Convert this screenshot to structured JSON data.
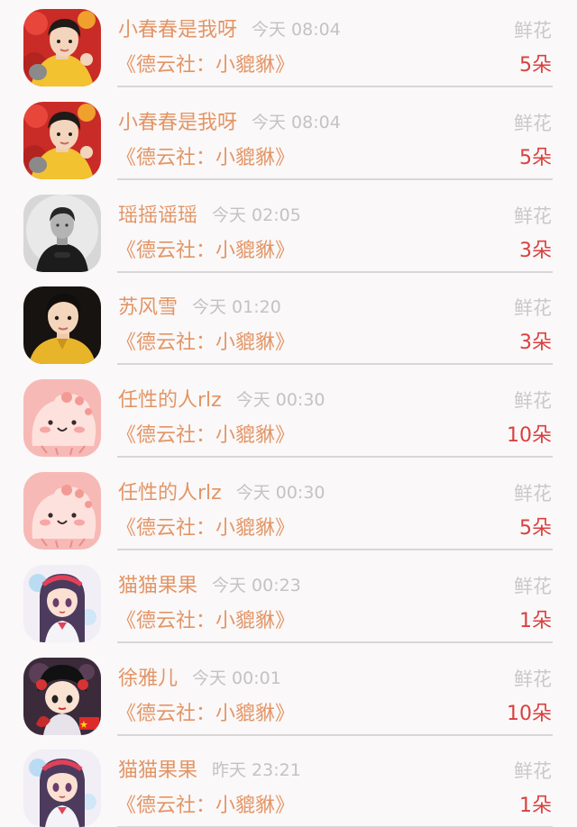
{
  "colors": {
    "name": "#e39566",
    "time": "#c3c3c3",
    "gift": "#c9c9c9",
    "count": "#d9403f",
    "divider": "#d8d6d6"
  },
  "rows": [
    {
      "avatar": "man-yellow-red-avatar",
      "name": "小春春是我呀",
      "time": "今天 08:04",
      "gift": "鲜花",
      "book": "《德云社：小貔貅》",
      "count": "5朵"
    },
    {
      "avatar": "man-yellow-red-avatar",
      "name": "小春春是我呀",
      "time": "今天 08:04",
      "gift": "鲜花",
      "book": "《德云社：小貔貅》",
      "count": "5朵"
    },
    {
      "avatar": "man-grayscale-avatar",
      "name": "瑶摇谣瑶",
      "time": "今天 02:05",
      "gift": "鲜花",
      "book": "《德云社：小貔貅》",
      "count": "3朵"
    },
    {
      "avatar": "man-dark-yellow-avatar",
      "name": "苏风雪",
      "time": "今天 01:20",
      "gift": "鲜花",
      "book": "《德云社：小貔貅》",
      "count": "3朵"
    },
    {
      "avatar": "pink-blob-avatar",
      "name": "任性的人rlz",
      "time": "今天 00:30",
      "gift": "鲜花",
      "book": "《德云社：小貔貅》",
      "count": "10朵"
    },
    {
      "avatar": "pink-blob-avatar",
      "name": "任性的人rlz",
      "time": "今天 00:30",
      "gift": "鲜花",
      "book": "《德云社：小貔貅》",
      "count": "5朵"
    },
    {
      "avatar": "anime-girl-avatar",
      "name": "猫猫果果",
      "time": "今天 00:23",
      "gift": "鲜花",
      "book": "《德云社：小貔貅》",
      "count": "1朵"
    },
    {
      "avatar": "chibi-opera-avatar",
      "name": "徐雅儿",
      "time": "今天 00:01",
      "gift": "鲜花",
      "book": "《德云社：小貔貅》",
      "count": "10朵"
    },
    {
      "avatar": "anime-girl-avatar",
      "name": "猫猫果果",
      "time": "昨天 23:21",
      "gift": "鲜花",
      "book": "《德云社：小貔貅》",
      "count": "1朵"
    }
  ]
}
